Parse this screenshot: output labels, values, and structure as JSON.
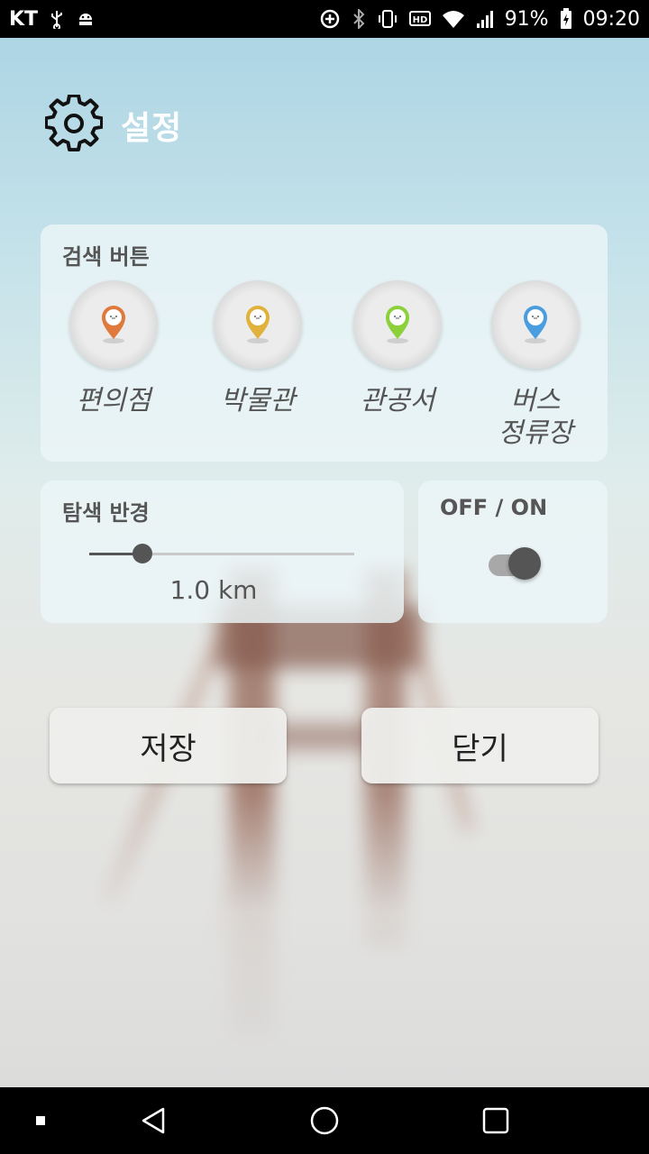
{
  "status_bar": {
    "carrier": "KT",
    "battery": "91%",
    "time": "09:20"
  },
  "header": {
    "title": "설정",
    "icon": "gear-icon"
  },
  "search_buttons": {
    "label": "검색 버튼",
    "items": [
      {
        "label": "편의점",
        "pin_color": "#e07a3c"
      },
      {
        "label": "박물관",
        "pin_color": "#e0b23c"
      },
      {
        "label": "관공서",
        "pin_color": "#8cd13c"
      },
      {
        "label_line1": "버스",
        "label_line2": "정류장",
        "pin_color": "#4a9ee0"
      }
    ]
  },
  "search_radius": {
    "label": "탐색 반경",
    "value": "1.0 km",
    "slider_fraction": 0.2
  },
  "toggle": {
    "label": "OFF / ON",
    "state": "on"
  },
  "actions": {
    "save_label": "저장",
    "close_label": "닫기"
  },
  "colors": {
    "card_bg": "#ecf5f8",
    "control": "#555555",
    "sky_top": "#a9d3e3"
  }
}
